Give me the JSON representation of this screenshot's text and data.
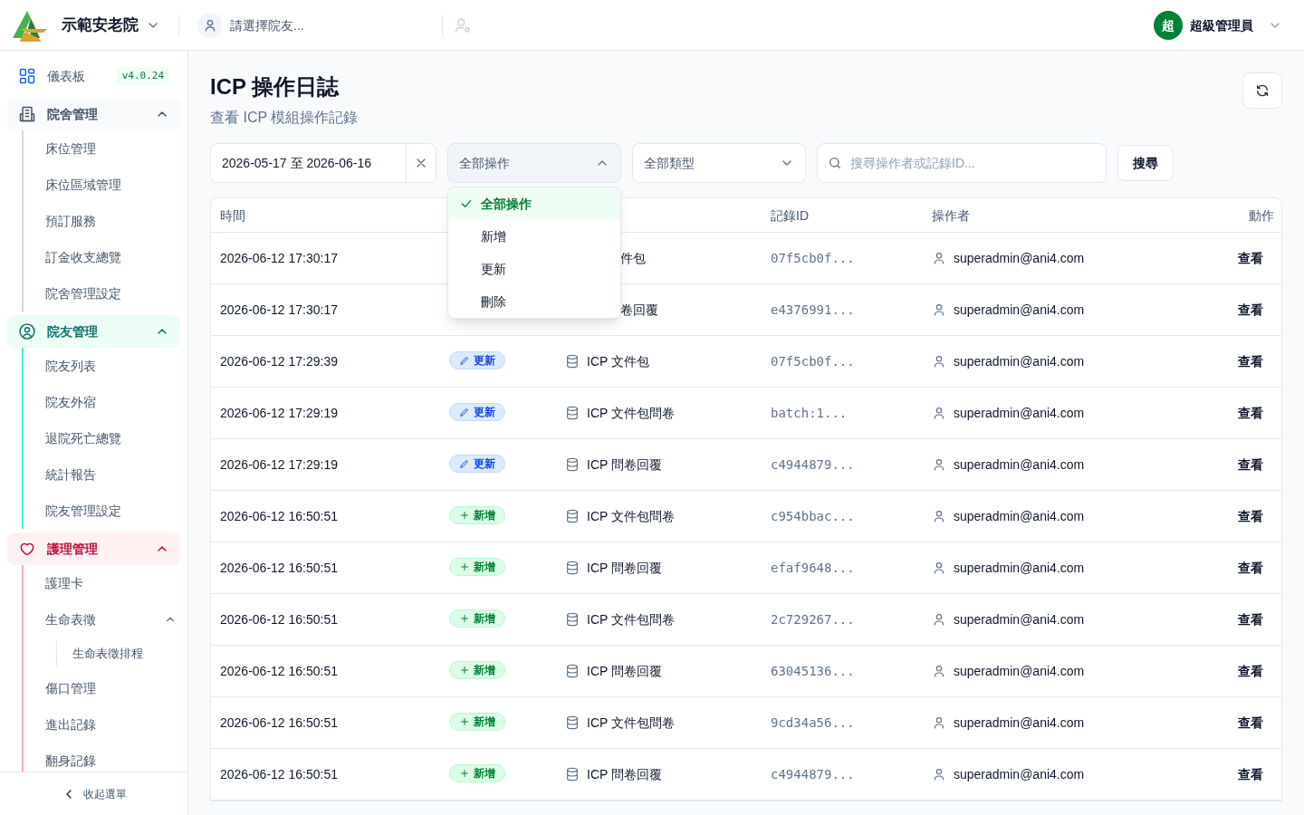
{
  "header": {
    "org_name": "示範安老院",
    "resident_placeholder": "請選擇院友...",
    "user": {
      "avatar": "超",
      "name": "超級管理員"
    }
  },
  "sidebar": {
    "dashboard": {
      "label": "儀表板",
      "badge": "v4.0.24"
    },
    "groups": [
      {
        "label": "院舍管理",
        "expanded": true,
        "color": "#475569",
        "children": [
          {
            "label": "床位管理"
          },
          {
            "label": "床位區域管理"
          },
          {
            "label": "預訂服務"
          },
          {
            "label": "訂金收支總覽"
          },
          {
            "label": "院舍管理設定"
          }
        ]
      },
      {
        "label": "院友管理",
        "expanded": true,
        "color": "#0f766e",
        "children": [
          {
            "label": "院友列表"
          },
          {
            "label": "院友外宿"
          },
          {
            "label": "退院死亡總覽"
          },
          {
            "label": "統計報告"
          },
          {
            "label": "院友管理設定"
          }
        ]
      },
      {
        "label": "護理管理",
        "expanded": true,
        "color": "#be123c",
        "children": [
          {
            "label": "護理卡"
          },
          {
            "label": "生命表徵",
            "expanded": true,
            "children": [
              {
                "label": "生命表徵排程"
              }
            ]
          },
          {
            "label": "傷口管理"
          },
          {
            "label": "進出記錄"
          },
          {
            "label": "翻身記錄"
          }
        ]
      }
    ],
    "collapse": "收起選單"
  },
  "page": {
    "title": "ICP 操作日誌",
    "subtitle": "查看 ICP 模組操作記錄"
  },
  "filters": {
    "date_range": "2026-05-17 至 2026-06-16",
    "operation_select": {
      "value": "全部操作",
      "expanded": true,
      "options": [
        {
          "label": "全部操作",
          "selected": true
        },
        {
          "label": "新增",
          "selected": false
        },
        {
          "label": "更新",
          "selected": false
        },
        {
          "label": "刪除",
          "selected": false
        }
      ]
    },
    "type_select": {
      "value": "全部類型",
      "expanded": false
    },
    "search": {
      "placeholder": "搜尋操作者或記錄ID..."
    },
    "search_button": "搜尋"
  },
  "table": {
    "header": {
      "time": "時間",
      "record_id": "記錄ID",
      "operator": "操作者",
      "action": "動作"
    },
    "rows": [
      {
        "time": "2026-06-12 17:30:17",
        "type": "件包",
        "type_cut": true,
        "record_id": "07f5cb0f...",
        "operator": "superadmin@ani4.com",
        "action": "查看"
      },
      {
        "time": "2026-06-12 17:30:17",
        "type": "卷回覆",
        "type_cut": true,
        "record_id": "e4376991...",
        "operator": "superadmin@ani4.com",
        "action": "查看"
      },
      {
        "time": "2026-06-12 17:29:39",
        "operation": {
          "kind": "update",
          "label": "更新"
        },
        "type": "ICP 文件包",
        "type_cut": false,
        "record_id": "07f5cb0f...",
        "operator": "superadmin@ani4.com",
        "action": "查看"
      },
      {
        "time": "2026-06-12 17:29:19",
        "operation": {
          "kind": "update",
          "label": "更新"
        },
        "type": "ICP 文件包問卷",
        "type_cut": false,
        "record_id": "batch:1...",
        "operator": "superadmin@ani4.com",
        "action": "查看"
      },
      {
        "time": "2026-06-12 17:29:19",
        "operation": {
          "kind": "update",
          "label": "更新"
        },
        "type": "ICP 問卷回覆",
        "type_cut": false,
        "record_id": "c4944879...",
        "operator": "superadmin@ani4.com",
        "action": "查看"
      },
      {
        "time": "2026-06-12 16:50:51",
        "operation": {
          "kind": "create",
          "label": "新增"
        },
        "type": "ICP 文件包問卷",
        "type_cut": false,
        "record_id": "c954bbac...",
        "operator": "superadmin@ani4.com",
        "action": "查看"
      },
      {
        "time": "2026-06-12 16:50:51",
        "operation": {
          "kind": "create",
          "label": "新增"
        },
        "type": "ICP 問卷回覆",
        "type_cut": false,
        "record_id": "efaf9648...",
        "operator": "superadmin@ani4.com",
        "action": "查看"
      },
      {
        "time": "2026-06-12 16:50:51",
        "operation": {
          "kind": "create",
          "label": "新增"
        },
        "type": "ICP 文件包問卷",
        "type_cut": false,
        "record_id": "2c729267...",
        "operator": "superadmin@ani4.com",
        "action": "查看"
      },
      {
        "time": "2026-06-12 16:50:51",
        "operation": {
          "kind": "create",
          "label": "新增"
        },
        "type": "ICP 問卷回覆",
        "type_cut": false,
        "record_id": "63045136...",
        "operator": "superadmin@ani4.com",
        "action": "查看"
      },
      {
        "time": "2026-06-12 16:50:51",
        "operation": {
          "kind": "create",
          "label": "新增"
        },
        "type": "ICP 文件包問卷",
        "type_cut": false,
        "record_id": "9cd34a56...",
        "operator": "superadmin@ani4.com",
        "action": "查看"
      },
      {
        "time": "2026-06-12 16:50:51",
        "operation": {
          "kind": "create",
          "label": "新增"
        },
        "type": "ICP 問卷回覆",
        "type_cut": false,
        "record_id": "c4944879...",
        "operator": "superadmin@ani4.com",
        "action": "查看"
      }
    ]
  }
}
